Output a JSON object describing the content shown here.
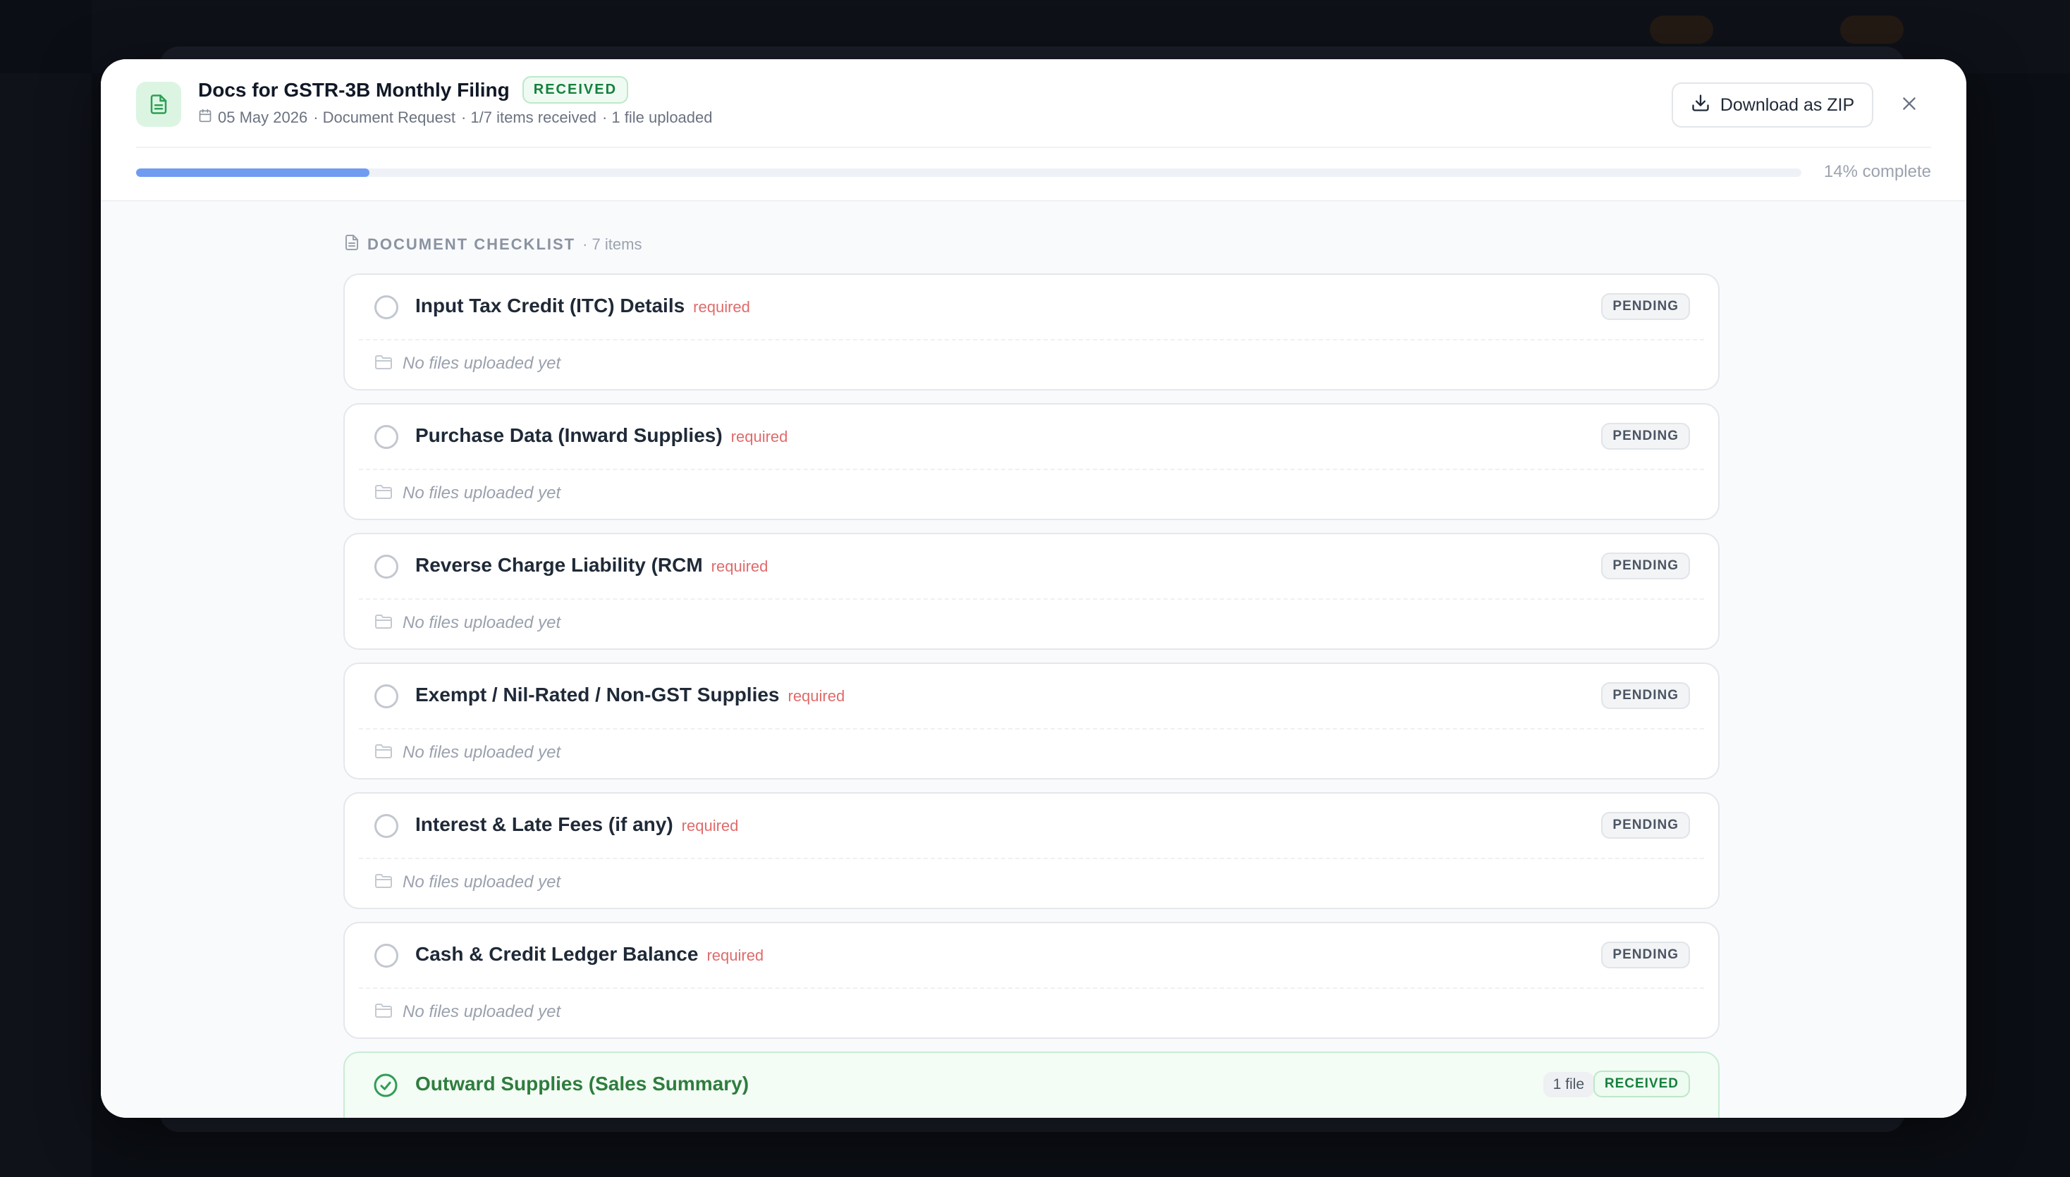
{
  "header": {
    "title": "Docs for GSTR-3B Monthly Filing",
    "status": "RECEIVED",
    "date": "05 May 2026",
    "meta_type": "· Document Request",
    "meta_items": "· 1/7 items received",
    "meta_files": "· 1 file uploaded",
    "download_label": "Download as ZIP"
  },
  "progress": {
    "percent": 14,
    "label": "14% complete"
  },
  "checklist": {
    "title": "DOCUMENT CHECKLIST",
    "count": "· 7 items",
    "empty_text": "No files uploaded yet",
    "items": [
      {
        "name": "Input Tax Credit (ITC) Details",
        "required": "required",
        "status": "PENDING"
      },
      {
        "name": "Purchase Data (Inward Supplies)",
        "required": "required",
        "status": "PENDING"
      },
      {
        "name": "Reverse Charge Liability (RCM",
        "required": "required",
        "status": "PENDING"
      },
      {
        "name": "Exempt / Nil-Rated / Non-GST Supplies",
        "required": "required",
        "status": "PENDING"
      },
      {
        "name": "Interest & Late Fees (if any)",
        "required": "required",
        "status": "PENDING"
      },
      {
        "name": "Cash & Credit Ledger Balance",
        "required": "required",
        "status": "PENDING"
      },
      {
        "name": "Outward Supplies (Sales Summary)",
        "status": "RECEIVED",
        "files": "1 file"
      }
    ]
  },
  "colors": {
    "accent": "#6f9cf0",
    "received": "#15803d",
    "required": "#e06b6b"
  },
  "icons": {
    "header": "document-icon",
    "date": "calendar-icon",
    "download": "download-icon",
    "close": "close-icon",
    "checklist": "document-icon",
    "empty": "folder-icon",
    "done": "check-circle-icon"
  }
}
